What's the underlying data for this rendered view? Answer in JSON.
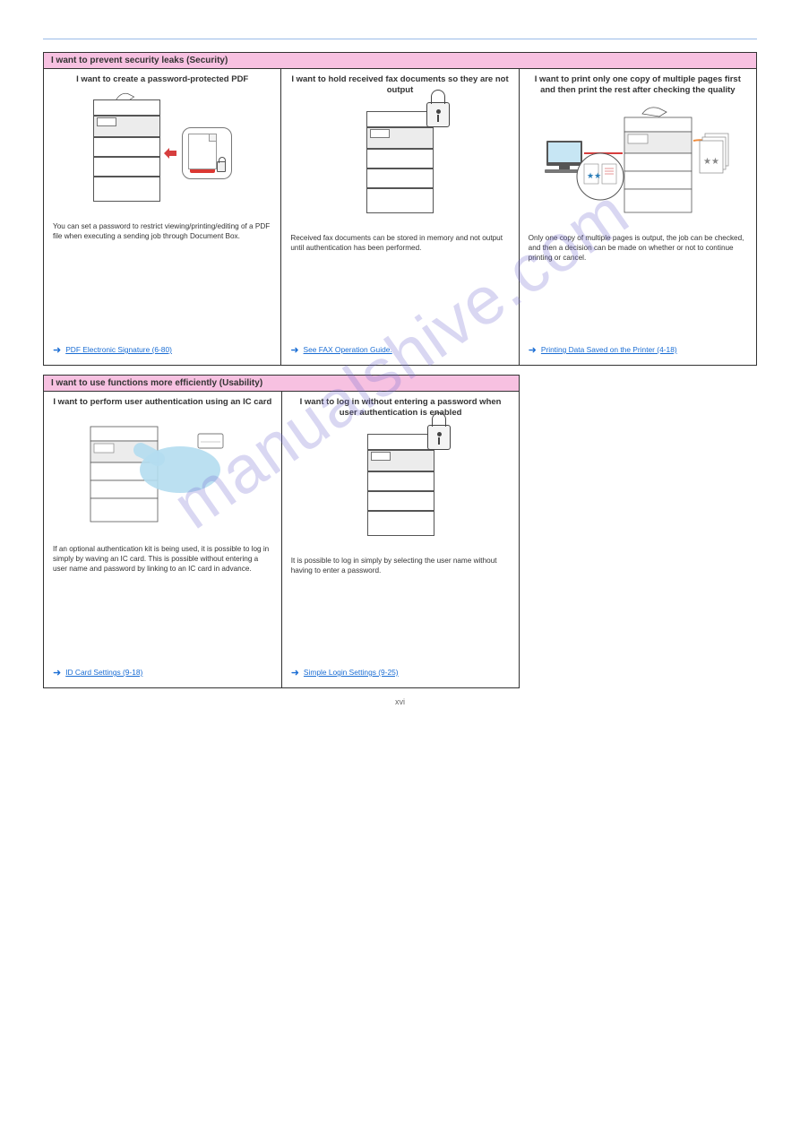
{
  "header": {
    "left": "",
    "right": ""
  },
  "watermark": "manualshive.com",
  "footer": "xvi",
  "sections": [
    {
      "title": "I want to prevent security leaks (Security)",
      "cards": [
        {
          "title": "I want to create a password-protected PDF",
          "text": "You can set a password to restrict viewing/printing/editing of a PDF file when executing a sending job through Document Box.",
          "link": "PDF Electronic Signature (6-80)"
        },
        {
          "title": "I want to hold received fax documents so they are not output",
          "text": "Received fax documents can be stored in memory and not output until authentication has been performed.",
          "link": "See FAX Operation Guide."
        },
        {
          "title": "I want to print only one copy of multiple pages first and then print the rest after checking the quality",
          "text": "Only one copy of multiple pages is output, the job can be checked, and then a decision can be made on whether or not to continue printing or cancel.",
          "link": "Printing Data Saved on the Printer (4-18)"
        }
      ]
    },
    {
      "title": "I want to use functions more efficiently (Usability)",
      "cards": [
        {
          "title": "I want to perform user authentication using an IC card",
          "text": "If an optional authentication kit is being used, it is possible to log in simply by waving an IC card. This is possible without entering a user name and password by linking to an IC card in advance.",
          "link": "ID Card Settings (9-18)"
        },
        {
          "title": "I want to log in without entering a password when user authentication is enabled",
          "text": "It is possible to log in simply by selecting the user name without having to enter a password.",
          "link": "Simple Login Settings (9-25)"
        }
      ]
    }
  ]
}
